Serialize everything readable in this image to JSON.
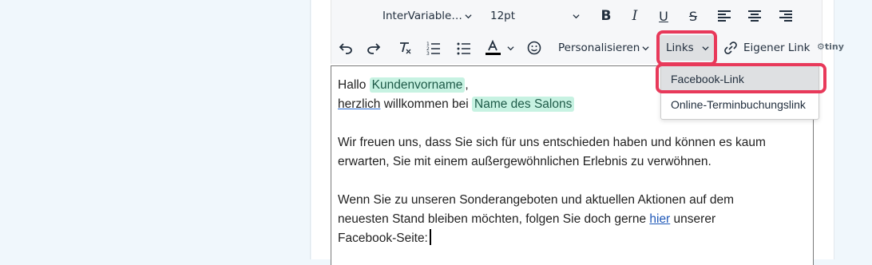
{
  "toolbar": {
    "font_family": "InterVariable…",
    "font_size": "12pt",
    "bold": "B",
    "italic": "I",
    "underline": "U",
    "strike": "S",
    "personalize_label": "Personalisieren",
    "links_label": "Links",
    "custom_link_label": "Eigener Link",
    "tiny_label": "tiny",
    "text_color_hex": "#000000"
  },
  "dropdown": {
    "items": [
      "Facebook-Link",
      "Online-Terminbuchungslink"
    ]
  },
  "editor": {
    "line1_prefix": "Hallo",
    "var_first_name": "Kundenvorname",
    "line1_suffix": ",",
    "line2_word": "herzlich",
    "line2_rest": "willkommen bei",
    "var_salon": "Name des Salons",
    "para2_line1": "Wir freuen uns, dass Sie sich für uns entschieden haben und können es kaum",
    "para2_line2": "erwarten, Sie mit einem außergewöhnlichen Erlebnis zu verwöhnen.",
    "para3_line1": "Wenn Sie zu unseren Sonderangeboten und aktuellen Aktionen auf dem",
    "para3_line2_a": "neuesten Stand bleiben möchten, folgen Sie doch gerne",
    "para3_link": "hier",
    "para3_line2_b": "unserer",
    "para3_line3": "Facebook-Seite:"
  },
  "colors": {
    "highlight": "#e8395a",
    "variable_bg": "#c7f2e2",
    "link": "#1f58b8"
  }
}
